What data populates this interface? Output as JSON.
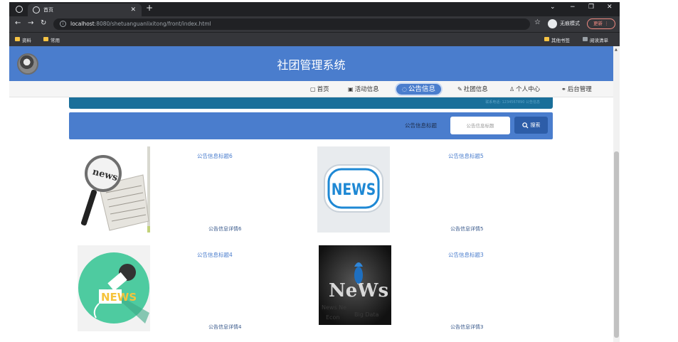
{
  "browser": {
    "tab_title": "首页",
    "url_host": "localhost",
    "url_path": ":8080/shetuanguanlixitong/front/index.html",
    "incognito_label": "无痕模式",
    "update_label": "更新",
    "bookmarks": [
      "资料",
      "常用"
    ],
    "bookmarks_right": [
      "其他书签",
      "阅读清单"
    ]
  },
  "header": {
    "title": "社团管理系统"
  },
  "nav": {
    "items": [
      {
        "label": "首页",
        "icon": "home-icon",
        "glyph": "▢"
      },
      {
        "label": "活动信息",
        "icon": "calendar-icon",
        "glyph": "▣"
      },
      {
        "label": "公告信息",
        "icon": "bell-icon",
        "glyph": "◌"
      },
      {
        "label": "社团信息",
        "icon": "edit-icon",
        "glyph": "✎"
      },
      {
        "label": "个人中心",
        "icon": "user-icon",
        "glyph": "♙"
      },
      {
        "label": "后台管理",
        "icon": "link-icon",
        "glyph": "⚭"
      }
    ],
    "active_index": 2
  },
  "banner": {
    "left": "",
    "right": "联系电话: 1234567890  公告信息"
  },
  "search": {
    "label": "公告信息标题",
    "placeholder": "公告信息标题",
    "button_label": "搜索"
  },
  "notices": [
    {
      "title": "公告信息标题6",
      "detail": "公告信息详情6",
      "image": "magnifier-news-image"
    },
    {
      "title": "公告信息标题5",
      "detail": "公告信息详情5",
      "image": "news-badge-image"
    },
    {
      "title": "公告信息标题4",
      "detail": "公告信息详情4",
      "image": "microphone-news-image"
    },
    {
      "title": "公告信息标题3",
      "detail": "公告信息详情3",
      "image": "dark-news-image"
    }
  ],
  "colors": {
    "primary": "#4a7dcd",
    "chrome": "#202124"
  }
}
